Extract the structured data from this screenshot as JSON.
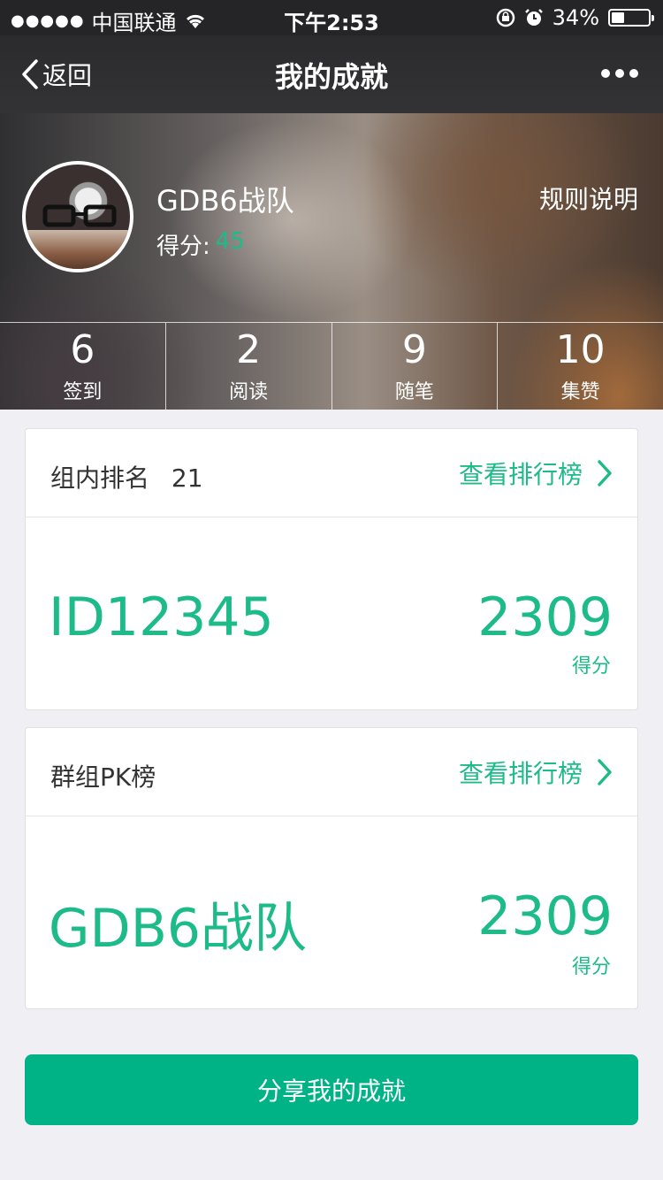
{
  "status_bar": {
    "carrier": "中国联通",
    "time": "下午2:53",
    "battery_text": "34%",
    "battery_level": 0.34
  },
  "nav": {
    "back_label": "返回",
    "title": "我的成就"
  },
  "profile": {
    "team_name": "GDB6战队",
    "score_label": "得分:",
    "score_value": "45",
    "rules_link": "规则说明"
  },
  "stats": [
    {
      "value": "6",
      "label": "签到"
    },
    {
      "value": "2",
      "label": "阅读"
    },
    {
      "value": "9",
      "label": "随笔"
    },
    {
      "value": "10",
      "label": "集赞"
    }
  ],
  "group_rank": {
    "title": "组内排名",
    "rank": "21",
    "link_label": "查看排行榜",
    "id_value": "ID12345",
    "score": "2309",
    "score_unit": "得分"
  },
  "group_pk": {
    "title": "群组PK榜",
    "link_label": "查看排行榜",
    "team_value": "GDB6战队",
    "score": "2309",
    "score_unit": "得分"
  },
  "share_button": "分享我的成就",
  "colors": {
    "accent": "#1dbb88",
    "button": "#00b386",
    "nav_bg": "#2b2b2d",
    "page_bg": "#efeff4"
  }
}
